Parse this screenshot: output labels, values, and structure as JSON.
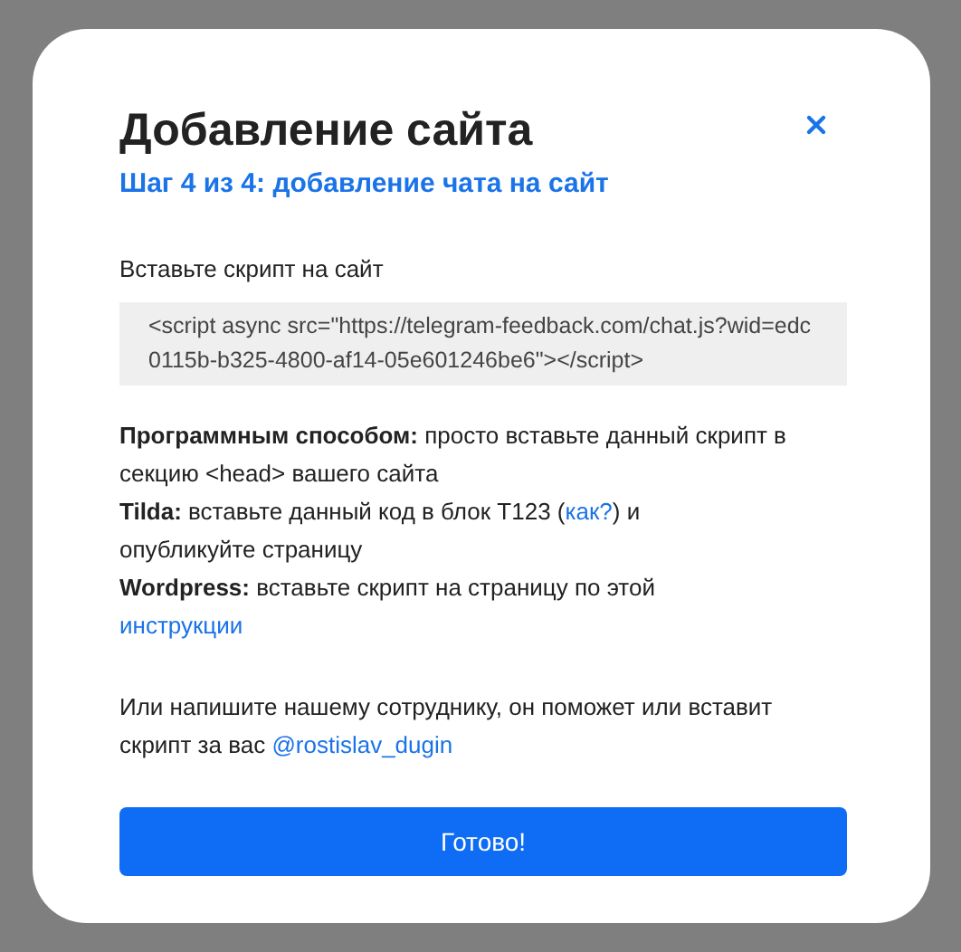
{
  "dialog": {
    "title": "Добавление сайта",
    "subtitle": "Шаг 4 из 4: добавление чата на сайт"
  },
  "script_label": "Вставьте скрипт на сайт",
  "script_code": "<script async src=\"https://telegram-feedback.com/chat.js?wid=edc0115b-b325-4800-af14-05e601246be6\"></script>",
  "instructions": [
    {
      "label": "Программным способом:",
      "parts": [
        {
          "kind": "text",
          "text": " просто вставьте данный скрипт в секцию <head> вашего сайта"
        }
      ]
    },
    {
      "label": "Tilda:",
      "parts": [
        {
          "kind": "text",
          "text": " вставьте данный код в блок T123 ("
        },
        {
          "kind": "link",
          "text": "как?"
        },
        {
          "kind": "text",
          "text": ") и опубликуйте страницу"
        }
      ]
    },
    {
      "label": "Wordpress:",
      "parts": [
        {
          "kind": "text",
          "text": " вставьте скрипт на страницу по этой "
        },
        {
          "kind": "link",
          "text": "инструкции"
        }
      ]
    }
  ],
  "contact": [
    {
      "kind": "text",
      "text": "Или напишите нашему сотруднику, он поможет или вставит скрипт за вас "
    },
    {
      "kind": "link",
      "text": "@rostislav_dugin"
    }
  ],
  "done_button": "Готово!"
}
